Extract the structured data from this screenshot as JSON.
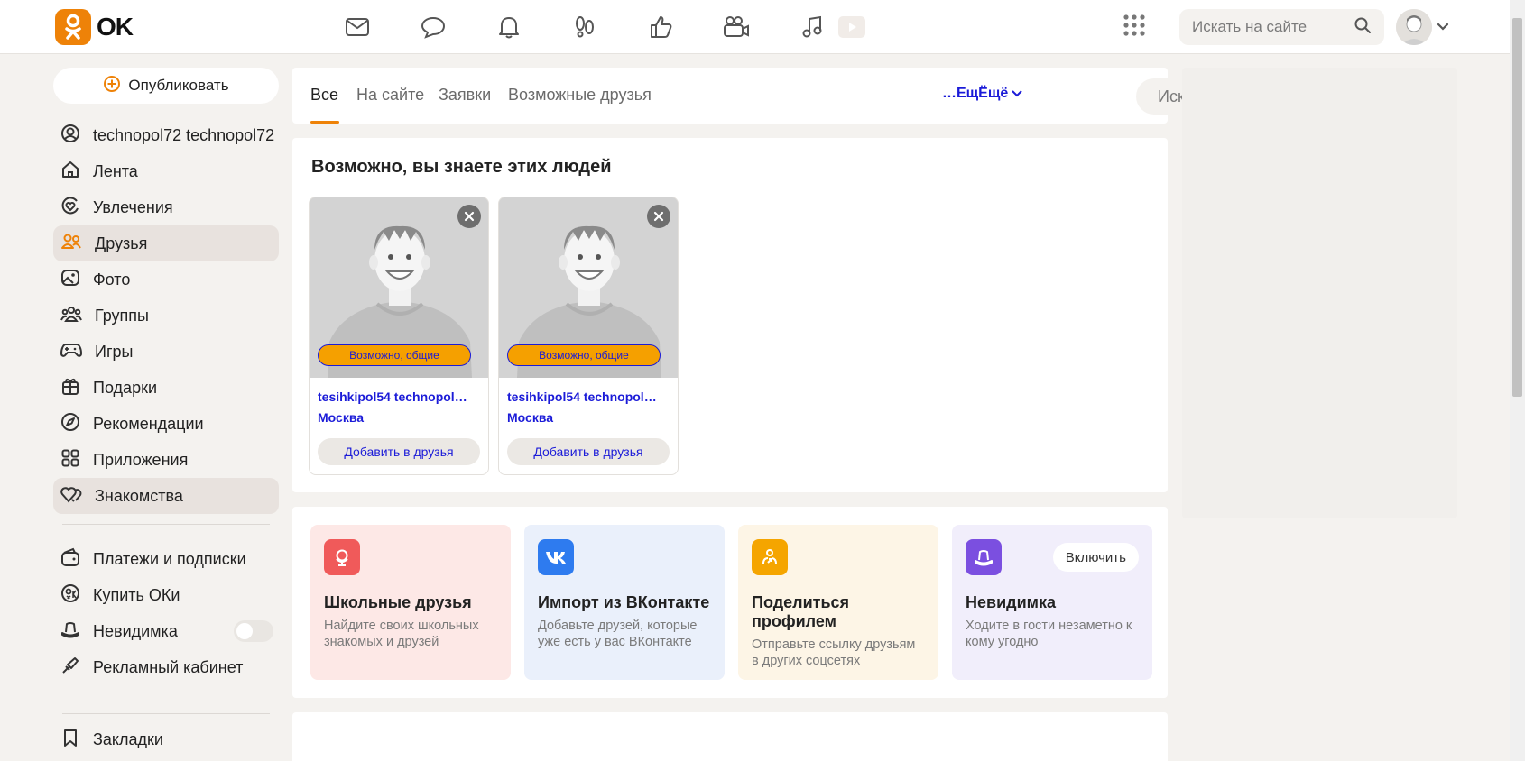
{
  "header": {
    "logo_text": "OK",
    "search_placeholder": "Искать на сайте",
    "icons": [
      "mail-icon",
      "chat-icon",
      "bell-icon",
      "footprints-icon",
      "like-icon",
      "video-camera-icon",
      "music-icon",
      "play-icon",
      "apps-grid-icon",
      "search-icon",
      "avatar",
      "chevron-down-icon"
    ]
  },
  "sidebar": {
    "publish_label": "Опубликовать",
    "items": [
      {
        "label": "technopol72 technopol72",
        "icon": "profile-icon",
        "active": false
      },
      {
        "label": "Лента",
        "icon": "home-icon",
        "active": false
      },
      {
        "label": "Увлечения",
        "icon": "heart-circle-icon",
        "active": false
      },
      {
        "label": "Друзья",
        "icon": "friends-icon",
        "active": true
      },
      {
        "label": "Фото",
        "icon": "photo-icon",
        "active": false
      },
      {
        "label": "Группы",
        "icon": "groups-icon",
        "active": false
      },
      {
        "label": "Игры",
        "icon": "gamepad-icon",
        "active": false
      },
      {
        "label": "Подарки",
        "icon": "gift-icon",
        "active": false
      },
      {
        "label": "Рекомендации",
        "icon": "compass-icon",
        "active": false
      },
      {
        "label": "Приложения",
        "icon": "apps-icon",
        "active": false
      },
      {
        "label": "Знакомства",
        "icon": "hearts-icon",
        "active": true
      }
    ],
    "items2": [
      {
        "label": "Платежи и подписки",
        "icon": "wallet-icon"
      },
      {
        "label": "Купить ОКи",
        "icon": "coin-icon"
      },
      {
        "label": "Невидимка",
        "icon": "hat-icon",
        "toggle": false
      },
      {
        "label": "Рекламный кабинет",
        "icon": "megaphone-icon"
      }
    ],
    "items3": [
      {
        "label": "Закладки",
        "icon": "bookmark-icon"
      }
    ]
  },
  "tabs": {
    "items": [
      "Все",
      "На сайте",
      "Заявки",
      "Возможные друзья"
    ],
    "active": "Все",
    "more_label": "…ЕщЁщё",
    "search_placeholder": "Искать друзей"
  },
  "suggestions": {
    "title": "Возможно, вы знаете этих людей",
    "cards": [
      {
        "badge": "Возможно, общие",
        "name": "tesihkipol54 technopol…",
        "city": "Москва",
        "add_label": "Добавить в друзья"
      },
      {
        "badge": "Возможно, общие",
        "name": "tesihkipol54 technopol…",
        "city": "Москва",
        "add_label": "Добавить в друзья"
      }
    ]
  },
  "features": [
    {
      "title": "Школьные друзья",
      "desc": "Найдите своих школьных знакомых и друзей",
      "icon": "school-globe-icon",
      "bg": "#fde8e6",
      "icon_bg": "#f05a5a"
    },
    {
      "title": "Импорт из ВКонтакте",
      "desc": "Добавьте друзей, которые уже есть у вас ВКонтакте",
      "icon": "vk-icon",
      "bg": "#eaf0fb",
      "icon_bg": "#2e7bef"
    },
    {
      "title": "Поделиться профилем",
      "desc": "Отправьте ссылку друзьям в других соцсетях",
      "icon": "share-icon",
      "bg": "#fdf5e6",
      "icon_bg": "#f5a500"
    },
    {
      "title": "Невидимка",
      "desc": "Ходите в гости незаметно к кому угодно",
      "icon": "invisible-hat-icon",
      "bg": "#f1eefb",
      "icon_bg": "#7b4fe0",
      "button": "Включить"
    }
  ],
  "colors": {
    "accent": "#ee8208",
    "link": "#1b1bd8"
  }
}
